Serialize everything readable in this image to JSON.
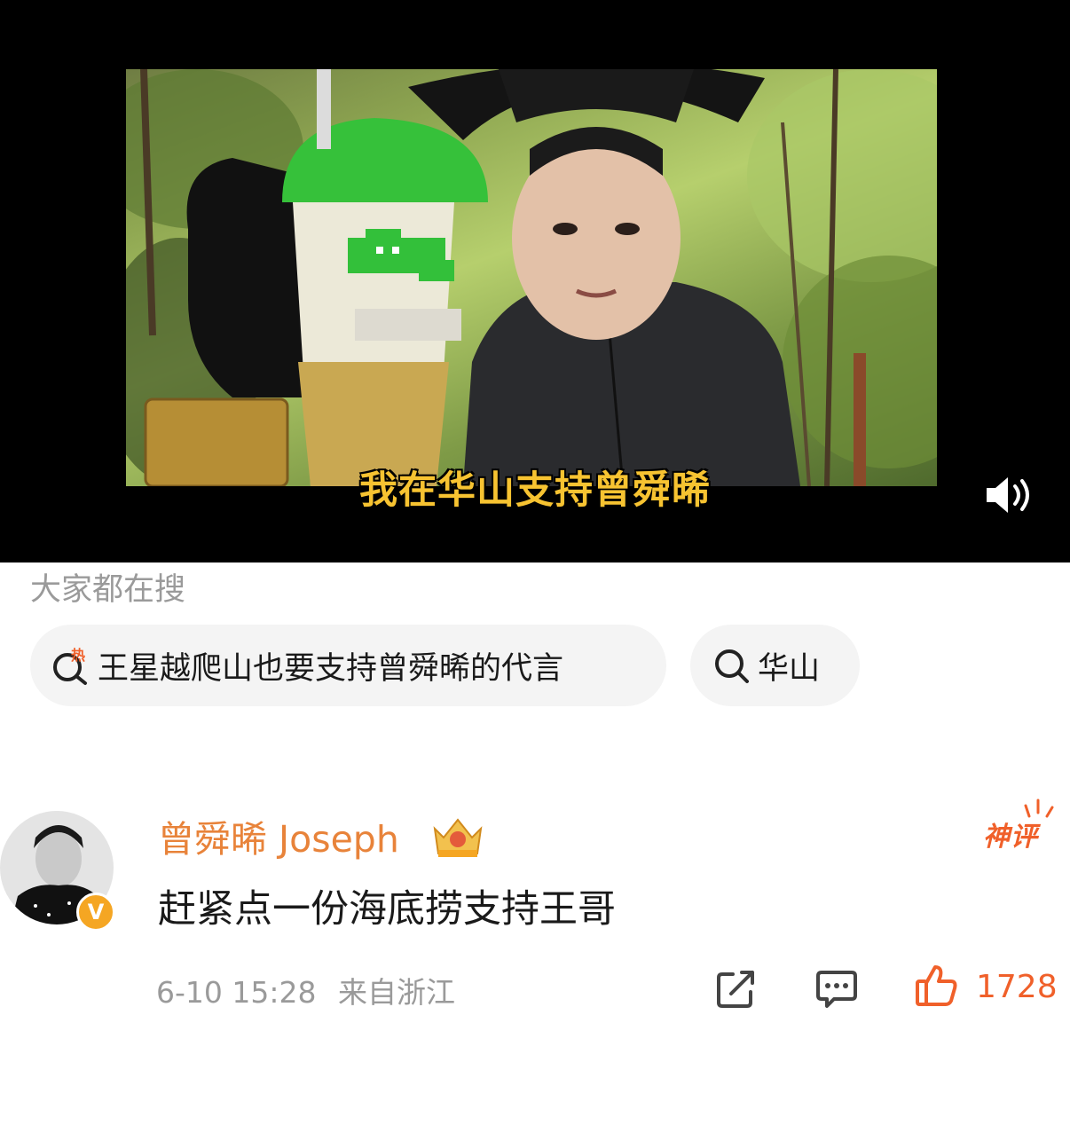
{
  "video": {
    "caption": "我在华山支持曾舜晞",
    "cup_label_icon": "crocodile-logo",
    "volume_icon": "speaker-icon"
  },
  "search": {
    "title": "大家都在搜",
    "chips": [
      {
        "icon": "hot-search-icon",
        "badge": "热",
        "text": "王星越爬山也要支持曾舜晞的代言"
      },
      {
        "icon": "search-icon",
        "text": "华山"
      }
    ]
  },
  "comment": {
    "username": "曾舜晞 Joseph",
    "verified_badge": "V",
    "badge_label": "神评",
    "text": "赶紧点一份海底捞支持王哥",
    "timestamp": "6-10 15:28",
    "location": "来自浙江",
    "like_count": "1728",
    "colors": {
      "username": "#e8833a",
      "like": "#f0602a",
      "badge": "#f0602a"
    }
  }
}
